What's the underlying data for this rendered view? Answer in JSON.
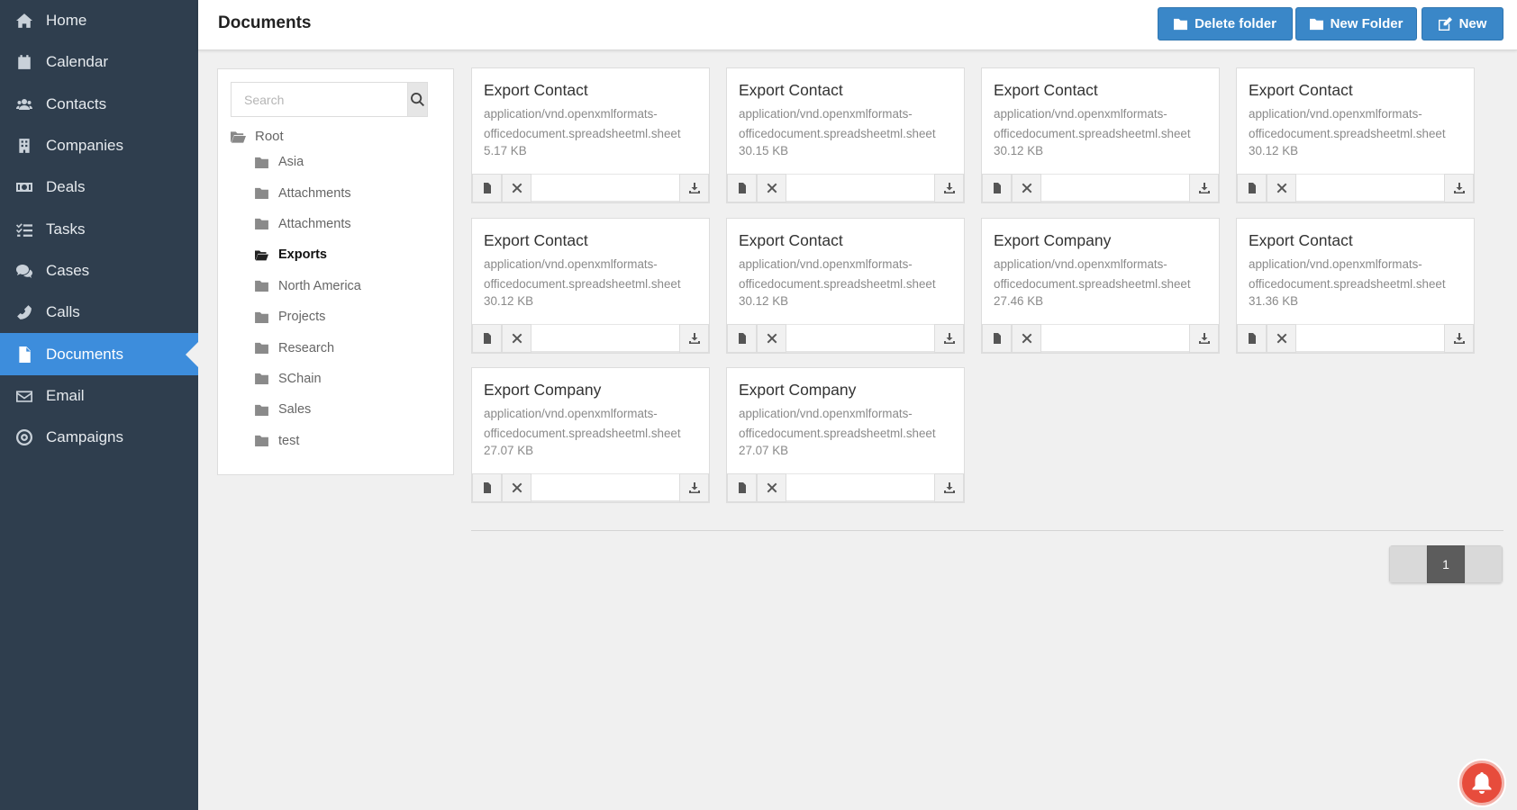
{
  "sidebar": {
    "items": [
      {
        "label": "Home",
        "icon": "home-icon"
      },
      {
        "label": "Calendar",
        "icon": "calendar-icon"
      },
      {
        "label": "Contacts",
        "icon": "users-icon"
      },
      {
        "label": "Companies",
        "icon": "building-icon"
      },
      {
        "label": "Deals",
        "icon": "money-icon"
      },
      {
        "label": "Tasks",
        "icon": "tasks-icon"
      },
      {
        "label": "Cases",
        "icon": "comments-icon"
      },
      {
        "label": "Calls",
        "icon": "phone-icon"
      },
      {
        "label": "Documents",
        "icon": "file-icon",
        "active": true
      },
      {
        "label": "Email",
        "icon": "envelope-icon"
      },
      {
        "label": "Campaigns",
        "icon": "bullseye-icon"
      }
    ]
  },
  "header": {
    "title": "Documents",
    "delete_folder_label": "Delete folder",
    "new_folder_label": "New Folder",
    "new_label": "New"
  },
  "folders": {
    "search_placeholder": "Search",
    "root_label": "Root",
    "items": [
      {
        "label": "Asia"
      },
      {
        "label": "Attachments"
      },
      {
        "label": "Attachments"
      },
      {
        "label": "Exports",
        "selected": true
      },
      {
        "label": "North America"
      },
      {
        "label": "Projects"
      },
      {
        "label": "Research"
      },
      {
        "label": "SChain"
      },
      {
        "label": "Sales"
      },
      {
        "label": "test"
      }
    ]
  },
  "documents": [
    {
      "title": "Export Contact",
      "mime": "application/vnd.openxmlformats-officedocument.spreadsheetml.sheet",
      "size": "5.17 KB"
    },
    {
      "title": "Export Contact",
      "mime": "application/vnd.openxmlformats-officedocument.spreadsheetml.sheet",
      "size": "30.15 KB"
    },
    {
      "title": "Export Contact",
      "mime": "application/vnd.openxmlformats-officedocument.spreadsheetml.sheet",
      "size": "30.12 KB"
    },
    {
      "title": "Export Contact",
      "mime": "application/vnd.openxmlformats-officedocument.spreadsheetml.sheet",
      "size": "30.12 KB"
    },
    {
      "title": "Export Contact",
      "mime": "application/vnd.openxmlformats-officedocument.spreadsheetml.sheet",
      "size": "30.12 KB"
    },
    {
      "title": "Export Contact",
      "mime": "application/vnd.openxmlformats-officedocument.spreadsheetml.sheet",
      "size": "30.12 KB"
    },
    {
      "title": "Export Company",
      "mime": "application/vnd.openxmlformats-officedocument.spreadsheetml.sheet",
      "size": "27.46 KB"
    },
    {
      "title": "Export Contact",
      "mime": "application/vnd.openxmlformats-officedocument.spreadsheetml.sheet",
      "size": "31.36 KB"
    },
    {
      "title": "Export Company",
      "mime": "application/vnd.openxmlformats-officedocument.spreadsheetml.sheet",
      "size": "27.07 KB"
    },
    {
      "title": "Export Company",
      "mime": "application/vnd.openxmlformats-officedocument.spreadsheetml.sheet",
      "size": "27.07 KB"
    }
  ],
  "pagination": {
    "current_page": "1"
  },
  "colors": {
    "sidebar_bg": "#2f3e4e",
    "accent": "#3d8ddc",
    "button": "#3a87c8",
    "bell": "#e74c3c"
  }
}
